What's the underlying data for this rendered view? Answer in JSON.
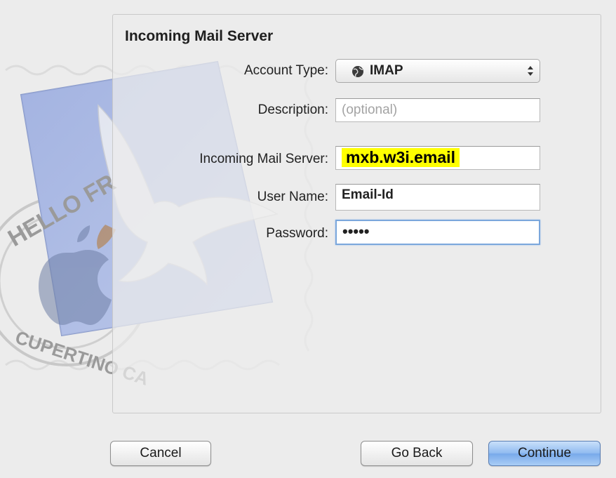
{
  "form": {
    "section_title": "Incoming Mail Server",
    "account_type": {
      "label": "Account Type:",
      "value": "IMAP",
      "icon": "globe-icon"
    },
    "description": {
      "label": "Description:",
      "value": "",
      "placeholder": "(optional)"
    },
    "server": {
      "label": "Incoming Mail Server:",
      "value": "mxb.w3i.email",
      "highlight_color": "#ffff00"
    },
    "username": {
      "label": "User Name:",
      "value": "Email-Id"
    },
    "password": {
      "label": "Password:",
      "masked_value": "•••••"
    }
  },
  "stamp": {
    "top_text": "HELLO FR",
    "bottom_text": "CUPERTINO CA"
  },
  "buttons": {
    "cancel": "Cancel",
    "go_back": "Go Back",
    "continue": "Continue"
  },
  "colors": {
    "primary_button": "#8fbaf0",
    "focus_ring": "#7ba7dc"
  }
}
